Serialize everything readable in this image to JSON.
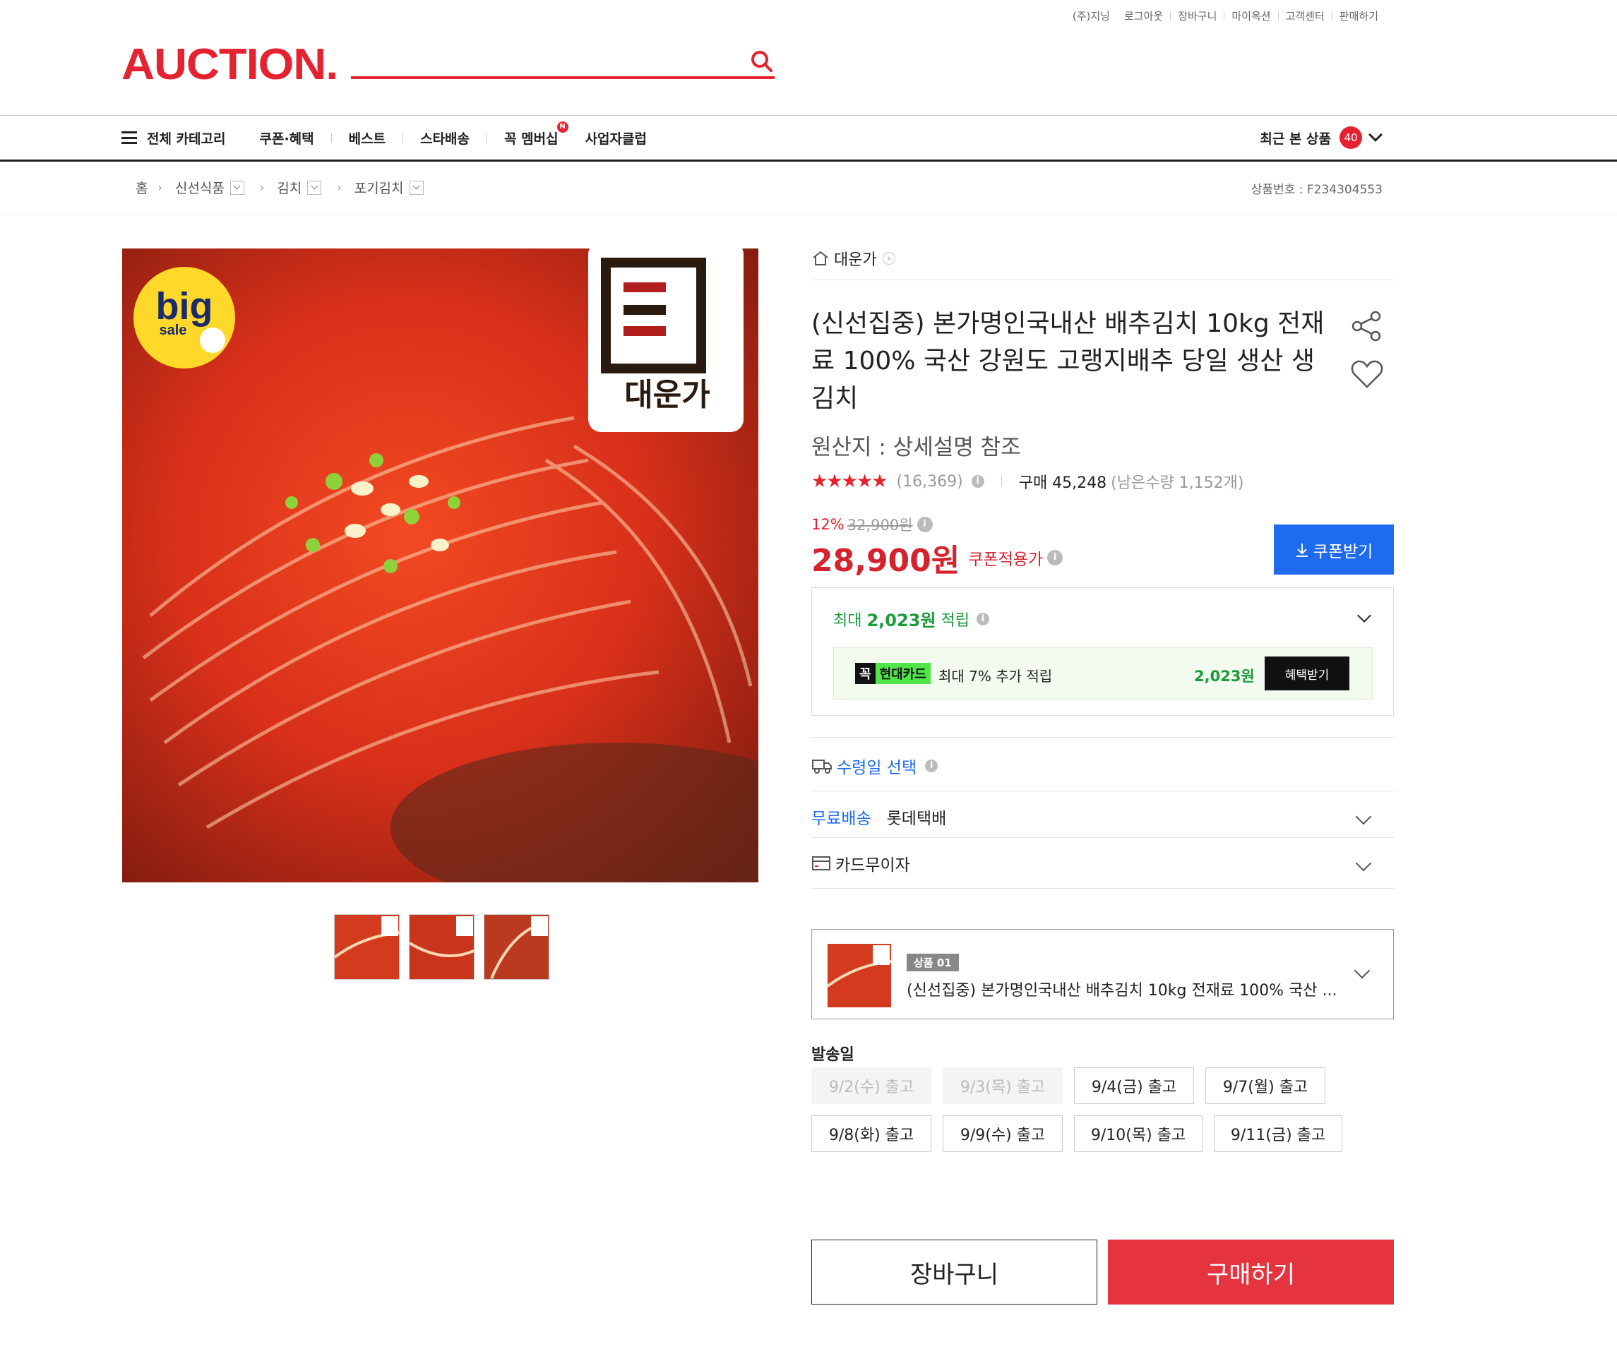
{
  "util_links": [
    "(주)지닝",
    "로그아웃",
    "장바구니",
    "마이옥션",
    "고객센터",
    "판매하기"
  ],
  "logo": "AUCTION.",
  "nav": {
    "all_category": "전체 카테고리",
    "items": [
      "쿠폰·혜택",
      "베스트",
      "스타배송",
      "꼭 멤버십",
      "사업자클럽"
    ],
    "membership_badge": "N",
    "recent_label": "최근 본 상품",
    "recent_count": "40"
  },
  "breadcrumb": [
    "홈",
    "신선식품",
    "김치",
    "포기김치"
  ],
  "product_no": "상품번호 : F234304553",
  "image": {
    "badge_big": "big",
    "badge_sale": "sale",
    "brand_logo_text": "대운가"
  },
  "store_name": "대운가",
  "title": "(신선집중) 본가명인국내산 배추김치 10kg 전재료 100% 국산 강원도 고랭지배추 당일 생산 생김치",
  "origin": "원산지 : 상세설명 참조",
  "rating": {
    "stars": "★★★★★",
    "reviews": "(16,369)",
    "purchase_label": "구매 45,248",
    "remaining": "(남은수량 1,152개)"
  },
  "price": {
    "discount_pct": "12%",
    "original": "32,900원",
    "sale": "28,900원",
    "label": "쿠폰적용가"
  },
  "coupon_button": "쿠폰받기",
  "points": {
    "prefix": "최대 ",
    "amount": "2,023원",
    "suffix": " 적립",
    "card_k": "꼭",
    "card_name": "현대카드",
    "card_text": "최대 7% 추가 적립",
    "card_amount": "2,023원",
    "benefit_button": "혜택받기"
  },
  "delivery_select": "수령일 선택",
  "shipping": {
    "free": "무료배송",
    "carrier": "롯데택배"
  },
  "card_installment": "카드무이자",
  "option": {
    "tag": "상품 01",
    "text": "(신선집중) 본가명인국내산 배추김치 10kg 전재료 100% 국산 ..."
  },
  "send_date_label": "발송일",
  "dates": [
    {
      "label": "9/2(수) 출고",
      "disabled": true
    },
    {
      "label": "9/3(목) 출고",
      "disabled": true
    },
    {
      "label": "9/4(금) 출고",
      "disabled": false
    },
    {
      "label": "9/7(월) 출고",
      "disabled": false
    },
    {
      "label": "9/8(화) 출고",
      "disabled": false
    },
    {
      "label": "9/9(수) 출고",
      "disabled": false
    },
    {
      "label": "9/10(목) 출고",
      "disabled": false
    },
    {
      "label": "9/11(금) 출고",
      "disabled": false
    }
  ],
  "cart_button": "장바구니",
  "buy_button": "구매하기",
  "colors": {
    "brand": "#e5222f",
    "blue": "#1f6bf0",
    "green": "#1a9b3c",
    "buy": "#e5333f"
  }
}
